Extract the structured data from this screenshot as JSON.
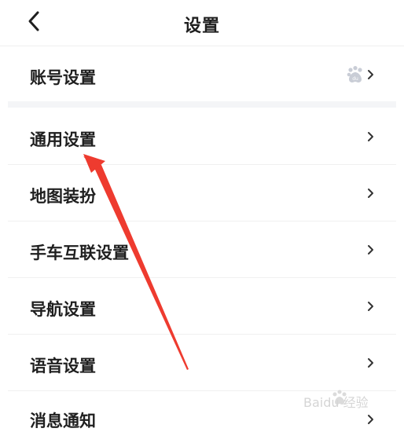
{
  "header": {
    "title": "设置",
    "back_icon": "chevron-left-icon"
  },
  "account_row": {
    "label": "账号设置",
    "badge_icon": "baidu-paw-icon"
  },
  "menu": [
    {
      "label": "通用设置"
    },
    {
      "label": "地图装扮"
    },
    {
      "label": "手车互联设置"
    },
    {
      "label": "导航设置"
    },
    {
      "label": "语音设置"
    },
    {
      "label": "消息通知"
    }
  ],
  "colors": {
    "annotation_arrow": "#ee3b2f",
    "divider": "#f0f0f0",
    "section_gap": "#f4f5f7"
  },
  "watermark": {
    "text": "Baidu 经验",
    "icon": "baidu-paw-icon"
  }
}
